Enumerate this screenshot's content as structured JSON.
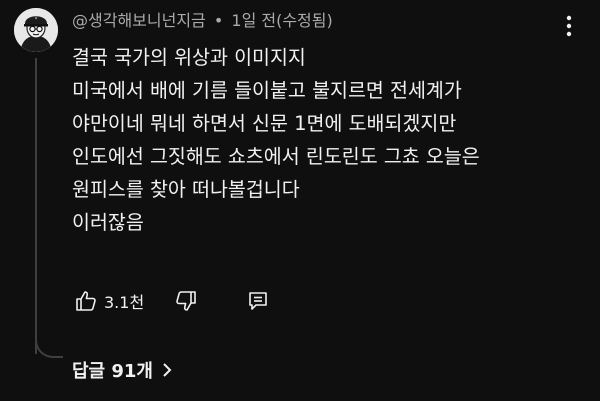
{
  "comment": {
    "author": "@생각해보니넌지금",
    "separator": "•",
    "timestamp": "1일 전(수정됨)",
    "lines": [
      "결국 국가의 위상과 이미지지",
      "미국에서 배에 기름 들이붙고 불지르면  전세계가",
      "야만이네 뭐네 하면서 신문 1면에 도배되겠지만",
      "인도에선 그짓해도 쇼츠에서 린도린도 그쵸 오늘은",
      "원피스를 찾아 떠나볼겁니다",
      "이러잖음"
    ]
  },
  "actions": {
    "like_count": "3.1천",
    "like_icon": "thumbs-up-icon",
    "dislike_icon": "thumbs-down-icon",
    "reply_icon": "comment-icon"
  },
  "replies": {
    "label": "답글 91개",
    "icon": "chevron-right-icon"
  },
  "header": {
    "more_icon": "more-vertical-icon"
  }
}
